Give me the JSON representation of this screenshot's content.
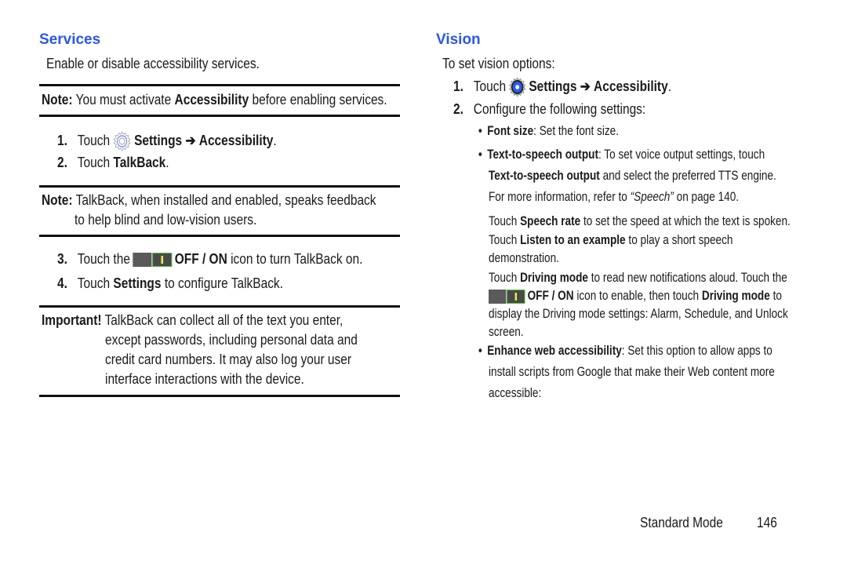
{
  "left": {
    "heading": "Services",
    "intro": "Enable or disable accessibility services.",
    "note1": {
      "label": "Note:",
      "pre": "You must activate",
      "bold": "Accessibility",
      "post": "before enabling services."
    },
    "steps_a": [
      {
        "num": "1.",
        "pre": "Touch",
        "icon": "settings-gear-icon",
        "bold1": "Settings",
        "arrow": "➔",
        "bold2": "Accessibility",
        "post": "."
      },
      {
        "num": "2.",
        "pre": "Touch",
        "bold": "TalkBack",
        "post": "."
      }
    ],
    "note2": {
      "label": "Note:",
      "line1": "TalkBack, when installed and enabled, speaks feedback",
      "line2": "to help blind and low-vision users."
    },
    "steps_b": [
      {
        "num": "3.",
        "pre": "Touch the",
        "icon": "off-on-toggle-icon",
        "bold": "OFF / ON",
        "post": "icon to turn TalkBack on."
      },
      {
        "num": "4.",
        "pre": "Touch",
        "bold": "Settings",
        "post": "to configure TalkBack."
      }
    ],
    "important": {
      "label": "Important!",
      "lines": [
        "TalkBack can collect all of the text you enter,",
        "except passwords, including personal data and",
        "credit card numbers. It may also log your user",
        "interface interactions with the device."
      ]
    }
  },
  "right": {
    "heading": "Vision",
    "intro": "To set vision options:",
    "step1": {
      "num": "1.",
      "pre": "Touch",
      "icon": "settings-gear-icon",
      "bold1": "Settings",
      "arrow": "➔",
      "bold2": "Accessibility",
      "post": "."
    },
    "step2": {
      "num": "2.",
      "text": "Configure the following settings:"
    },
    "font_size": {
      "bullet": "•",
      "bold": "Font size",
      "post": ": Set the font size."
    },
    "tts": {
      "bullet": "•",
      "bold": "Text-to-speech output",
      "post": ": To set voice output settings, touch",
      "line2_bold": "Text-to-speech output",
      "line2_post": "and select the preferred TTS engine.",
      "line3_pre": "For more information, refer to",
      "line3_italic": "“Speech”",
      "line3_post": "on page 140.",
      "rate_pre": "Touch",
      "rate_bold": "Speech rate",
      "rate_post": "to set the speed at which the text is spoken.",
      "listen_pre": "Touch",
      "listen_bold": "Listen to an example",
      "listen_post": "to play a short speech",
      "listen_line2": "demonstration."
    },
    "driving": {
      "pre": "Touch",
      "bold": "Driving mode",
      "post": "to read new notifications aloud. Touch the",
      "toggle_bold": "OFF / ON",
      "toggle_post": "icon to enable, then touch",
      "toggle_bold2": "Driving mode",
      "toggle_post2": "to",
      "line3": "display the Driving mode settings: Alarm, Schedule, and Unlock",
      "line4": "screen."
    },
    "web": {
      "bullet": "•",
      "bold": "Enhance web accessibility",
      "post": ": Set this option to allow apps to",
      "line2": "install scripts from Google that make their Web content more",
      "line3": "accessible:"
    }
  },
  "footer": {
    "mode": "Standard Mode",
    "page": "146"
  },
  "colors": {
    "heading": "#2a56f0",
    "toggle_on_border": "#4cbf2a"
  }
}
